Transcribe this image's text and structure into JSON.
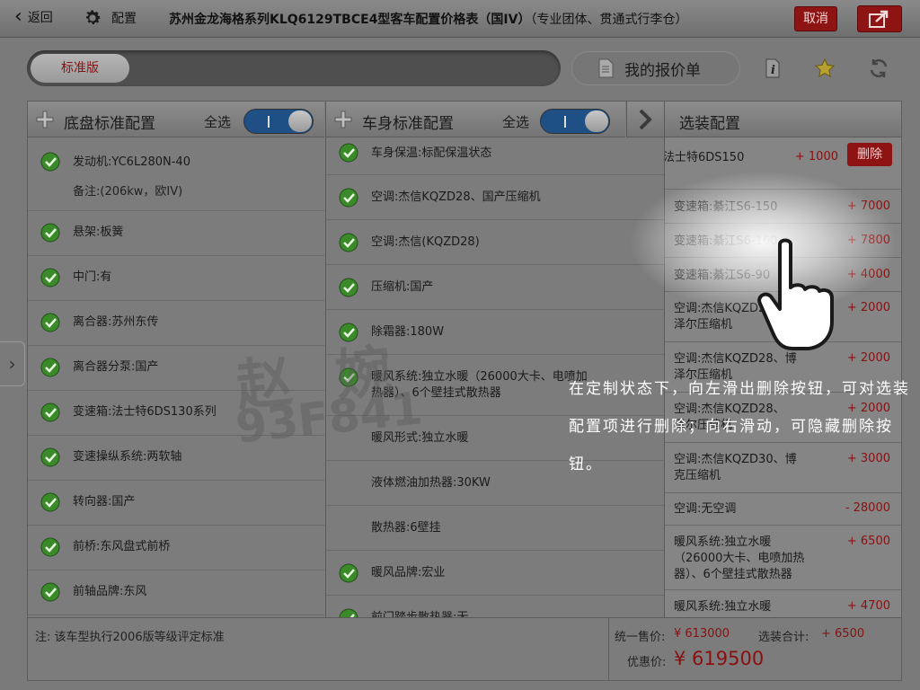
{
  "topbar": {
    "back_label": "返回",
    "config_label": "配置",
    "title_bold": "苏州金龙海格系列KLQ6129TBCE4型客车配置价格表（国IV）",
    "title_suffix": "（专业团体、贯通式行李仓）",
    "cancel_label": "取消"
  },
  "toolbar": {
    "standard_tab": "标准版",
    "quote_label": "我的报价单"
  },
  "col1": {
    "title": "底盘标准配置",
    "select_all": "全选",
    "items": [
      {
        "label": "发动机:YC6L280N-40",
        "note": "备注:(206kw，欧IV)"
      },
      {
        "label": "悬架:板簧"
      },
      {
        "label": "中门:有"
      },
      {
        "label": "离合器:苏州东传"
      },
      {
        "label": "离合器分泵:国产"
      },
      {
        "label": "变速箱:法士特6DS130系列"
      },
      {
        "label": "变速操纵系统:两软轴"
      },
      {
        "label": "转向器:国产"
      },
      {
        "label": "前桥:东风盘式前桥"
      },
      {
        "label": "前轴品牌:东风"
      }
    ]
  },
  "col2": {
    "title": "车身标准配置",
    "select_all": "全选",
    "items": [
      {
        "label": "车身保温:标配保温状态",
        "checked": true
      },
      {
        "label": "空调:杰信KQZD28、国产压缩机",
        "checked": true
      },
      {
        "label": "空调:杰信(KQZD28)",
        "checked": true
      },
      {
        "label": "压缩机:国产",
        "checked": true
      },
      {
        "label": "除霜器:180W",
        "checked": true
      },
      {
        "label": "暖风系统:独立水暖（26000大卡、电喷加",
        "label2": "热器）、6个壁挂式散热器",
        "checked": true
      },
      {
        "label": "暖风形式:独立水暖",
        "checked": false
      },
      {
        "label": "液体燃油加热器:30KW",
        "checked": false
      },
      {
        "label": "散热器:6壁挂",
        "checked": false
      },
      {
        "label": "暖风品牌:宏业",
        "checked": true
      },
      {
        "label": "前门踏步散热器:无",
        "checked": true
      }
    ]
  },
  "col3": {
    "title": "选装配置",
    "delete_label": "删除",
    "items": [
      {
        "label": "法士特6DS150",
        "price": "+ 1000"
      },
      {
        "label": "变速箱:綦江S6-150",
        "price": "+ 7000"
      },
      {
        "label": "变速箱:綦江S6-160",
        "price": "+ 7800"
      },
      {
        "label": "变速箱:綦江S6-90",
        "price": "+ 4000"
      },
      {
        "label": "空调:杰信KQZD28、",
        "label2": "泽尔压缩机",
        "price": "+ 2000"
      },
      {
        "label": "空调:杰信KQZD28、博",
        "label2": "泽尔压缩机",
        "price": "+ 2000"
      },
      {
        "label": "空调:杰信KQZD28、",
        "label2": "泽尔压缩机",
        "price": "+ 2000"
      },
      {
        "label": "空调:杰信KQZD30、博",
        "label2": "克压缩机",
        "price": "+ 3000"
      },
      {
        "label": "空调:无空调",
        "price": "- 28000"
      },
      {
        "label": "暖风系统:独立水暖",
        "label2": "（26000大卡、电喷加热",
        "label3": "器）、6个壁挂式散热器",
        "price": "+ 6500"
      },
      {
        "label": "暖风系统:独立水暖",
        "price": "+ 4700"
      }
    ]
  },
  "footer": {
    "note": "注:  该车型执行2006版等级评定标准",
    "unified_label": "统一售价:",
    "unified_value": "¥ 613000",
    "optional_label": "选装合计:",
    "optional_value": "+ 6500",
    "discount_label": "优惠价:",
    "discount_value": "¥  619500"
  },
  "watermark": {
    "line1": "赵  婉",
    "line2": "93F841"
  },
  "tip": {
    "text": "在定制状态下，向左滑出删除按钮，可对选装配置项进行删除；向右滑动，可隐藏删除按钮。"
  },
  "colors": {
    "accent_red": "#8e1414",
    "price_red": "#8a1010",
    "toggle_blue": "#1e4f85",
    "check_green": "#3a8a2a"
  }
}
